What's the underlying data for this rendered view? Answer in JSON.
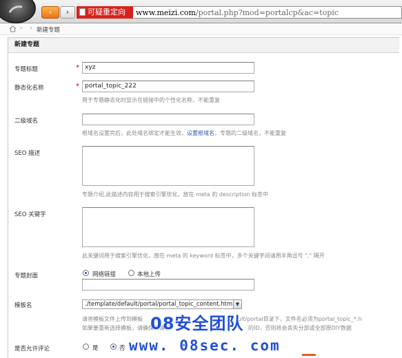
{
  "browser": {
    "back_glyph": "‹",
    "forward_glyph": "›",
    "tab_warning": "可疑重定向",
    "url_host": "www.meizi.com",
    "url_path": "/portal.php?mod=portalcp&ac=topic"
  },
  "breadcrumb": {
    "separator": "›",
    "current": "新建专题"
  },
  "panel": {
    "heading": "新建专题"
  },
  "form": {
    "title": {
      "label": "专题标题",
      "required_mark": "*",
      "value": "xyz"
    },
    "static_name": {
      "label": "静态化名称",
      "required_mark": "*",
      "value": "portal_topic_222",
      "hint": "用于专题静态化时显示在链接中的个性化名称，不能重复"
    },
    "subdomain": {
      "label": "二级域名",
      "value": "",
      "hint_before": "根域名设置完后，此处域名绑定才能生效，",
      "hint_link": "设置根域名",
      "hint_after": "，专题的二级域名，不能重复"
    },
    "seo_description": {
      "label": "SEO 描述",
      "value": "",
      "hint": "专题介绍,此描述内容用于搜索引擎优化，放在 meta 的 description 标签中"
    },
    "seo_keywords": {
      "label": "SEO 关键字",
      "value": "",
      "hint": "此关键词用于搜索引擎优化，放在 meta 的 keyword 标签中，多个关键字间请用半角逗号 \",\" 隔开"
    },
    "cover": {
      "label": "专题封面",
      "options": [
        "网络链接",
        "本地上传"
      ],
      "selected": "网络链接",
      "value": ""
    },
    "template": {
      "label": "模板名",
      "selected": "./template/default/portal/portal_topic_content.htm",
      "hint_line1_start": "请将模板文件上传到模板",
      "hint_line1_end": "ult/portal目录下，文件名必须为portal_topic_*.h",
      "hint_line2_start": "如果要重新选择模板，请确保新模板",
      "hint_line2_end": "的ID，否则将会丢失分部或全部原DIY数据"
    },
    "allow_comment": {
      "label": "是否允许评论",
      "options": [
        "是",
        "否"
      ],
      "selected": "否"
    }
  },
  "watermark": {
    "line1": "08安全团队",
    "line2": "www. 08sec. com"
  },
  "colors": {
    "back_button": "#e8741a",
    "warning_tag": "#d6231e",
    "required_star": "#d40000",
    "watermark": "#1f4fd9",
    "link": "#2b5fa8"
  },
  "icons": [
    "browser-orb-icon",
    "back-arrow-icon",
    "forward-arrow-icon",
    "page-icon",
    "home-icon",
    "dropdown-arrow-icon"
  ]
}
